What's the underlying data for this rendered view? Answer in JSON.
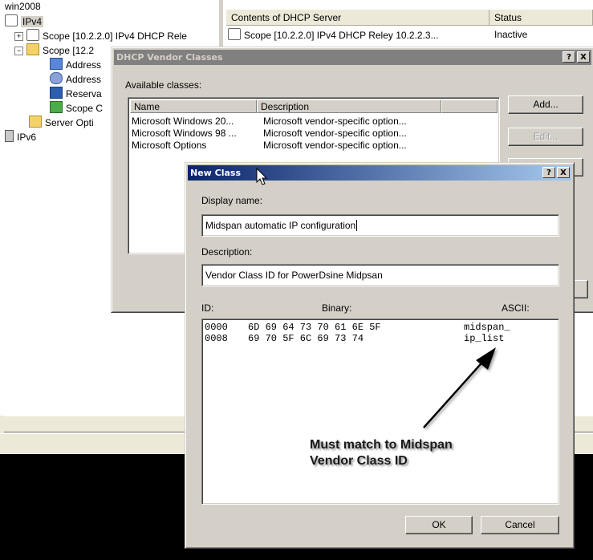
{
  "tree": {
    "server": "win2008",
    "ipv4": "IPv4",
    "scope1": "Scope [10.2.2.0] IPv4 DHCP Rele",
    "scope2": "Scope [12.2",
    "address_pool": "Address",
    "address_leases": "Address",
    "reservations": "Reserva",
    "scope_options": "Scope C",
    "server_options": "Server Opti",
    "ipv6": "IPv6"
  },
  "right_panel": {
    "columns": [
      "Contents of DHCP Server",
      "Status"
    ],
    "row": {
      "name": "Scope [10.2.2.0] IPv4 DHCP Reley 10.2.2.3...",
      "status": "Inactive"
    }
  },
  "vendor_dialog": {
    "title": "DHCP Vendor Classes",
    "help": "?",
    "close": "X",
    "available_label": "Available classes:",
    "columns": [
      "Name",
      "Description"
    ],
    "rows": [
      {
        "name": "Microsoft Windows 20...",
        "description": "Microsoft vendor-specific option..."
      },
      {
        "name": "Microsoft Windows 98 ...",
        "description": "Microsoft vendor-specific option..."
      },
      {
        "name": "Microsoft Options",
        "description": "Microsoft vendor-specific option..."
      }
    ],
    "buttons": {
      "add": "Add...",
      "edit": "Edit..."
    }
  },
  "new_class_dialog": {
    "title": "New Class",
    "help": "?",
    "close": "X",
    "display_name_label": "Display name:",
    "display_name_value": "Midspan automatic IP configuration",
    "description_label": "Description:",
    "description_value": "Vendor Class ID for PowerDsine Midpsan",
    "id_label": "ID:",
    "binary_label": "Binary:",
    "ascii_label": "ASCII:",
    "hex_lines": [
      {
        "offset": "0000",
        "bytes": "6D 69 64 73 70 61 6E 5F",
        "ascii": "midspan_"
      },
      {
        "offset": "0008",
        "bytes": "69 70 5F 6C 69 73 74",
        "ascii": "ip_list"
      }
    ],
    "ok": "OK",
    "cancel": "Cancel"
  },
  "annotation": {
    "line1": "Must match to Midspan",
    "line2": "Vendor Class ID"
  },
  "colors": {
    "active_title": "#0a246a",
    "inactive_title": "#808080",
    "dialog_face": "#d4d0c8"
  }
}
